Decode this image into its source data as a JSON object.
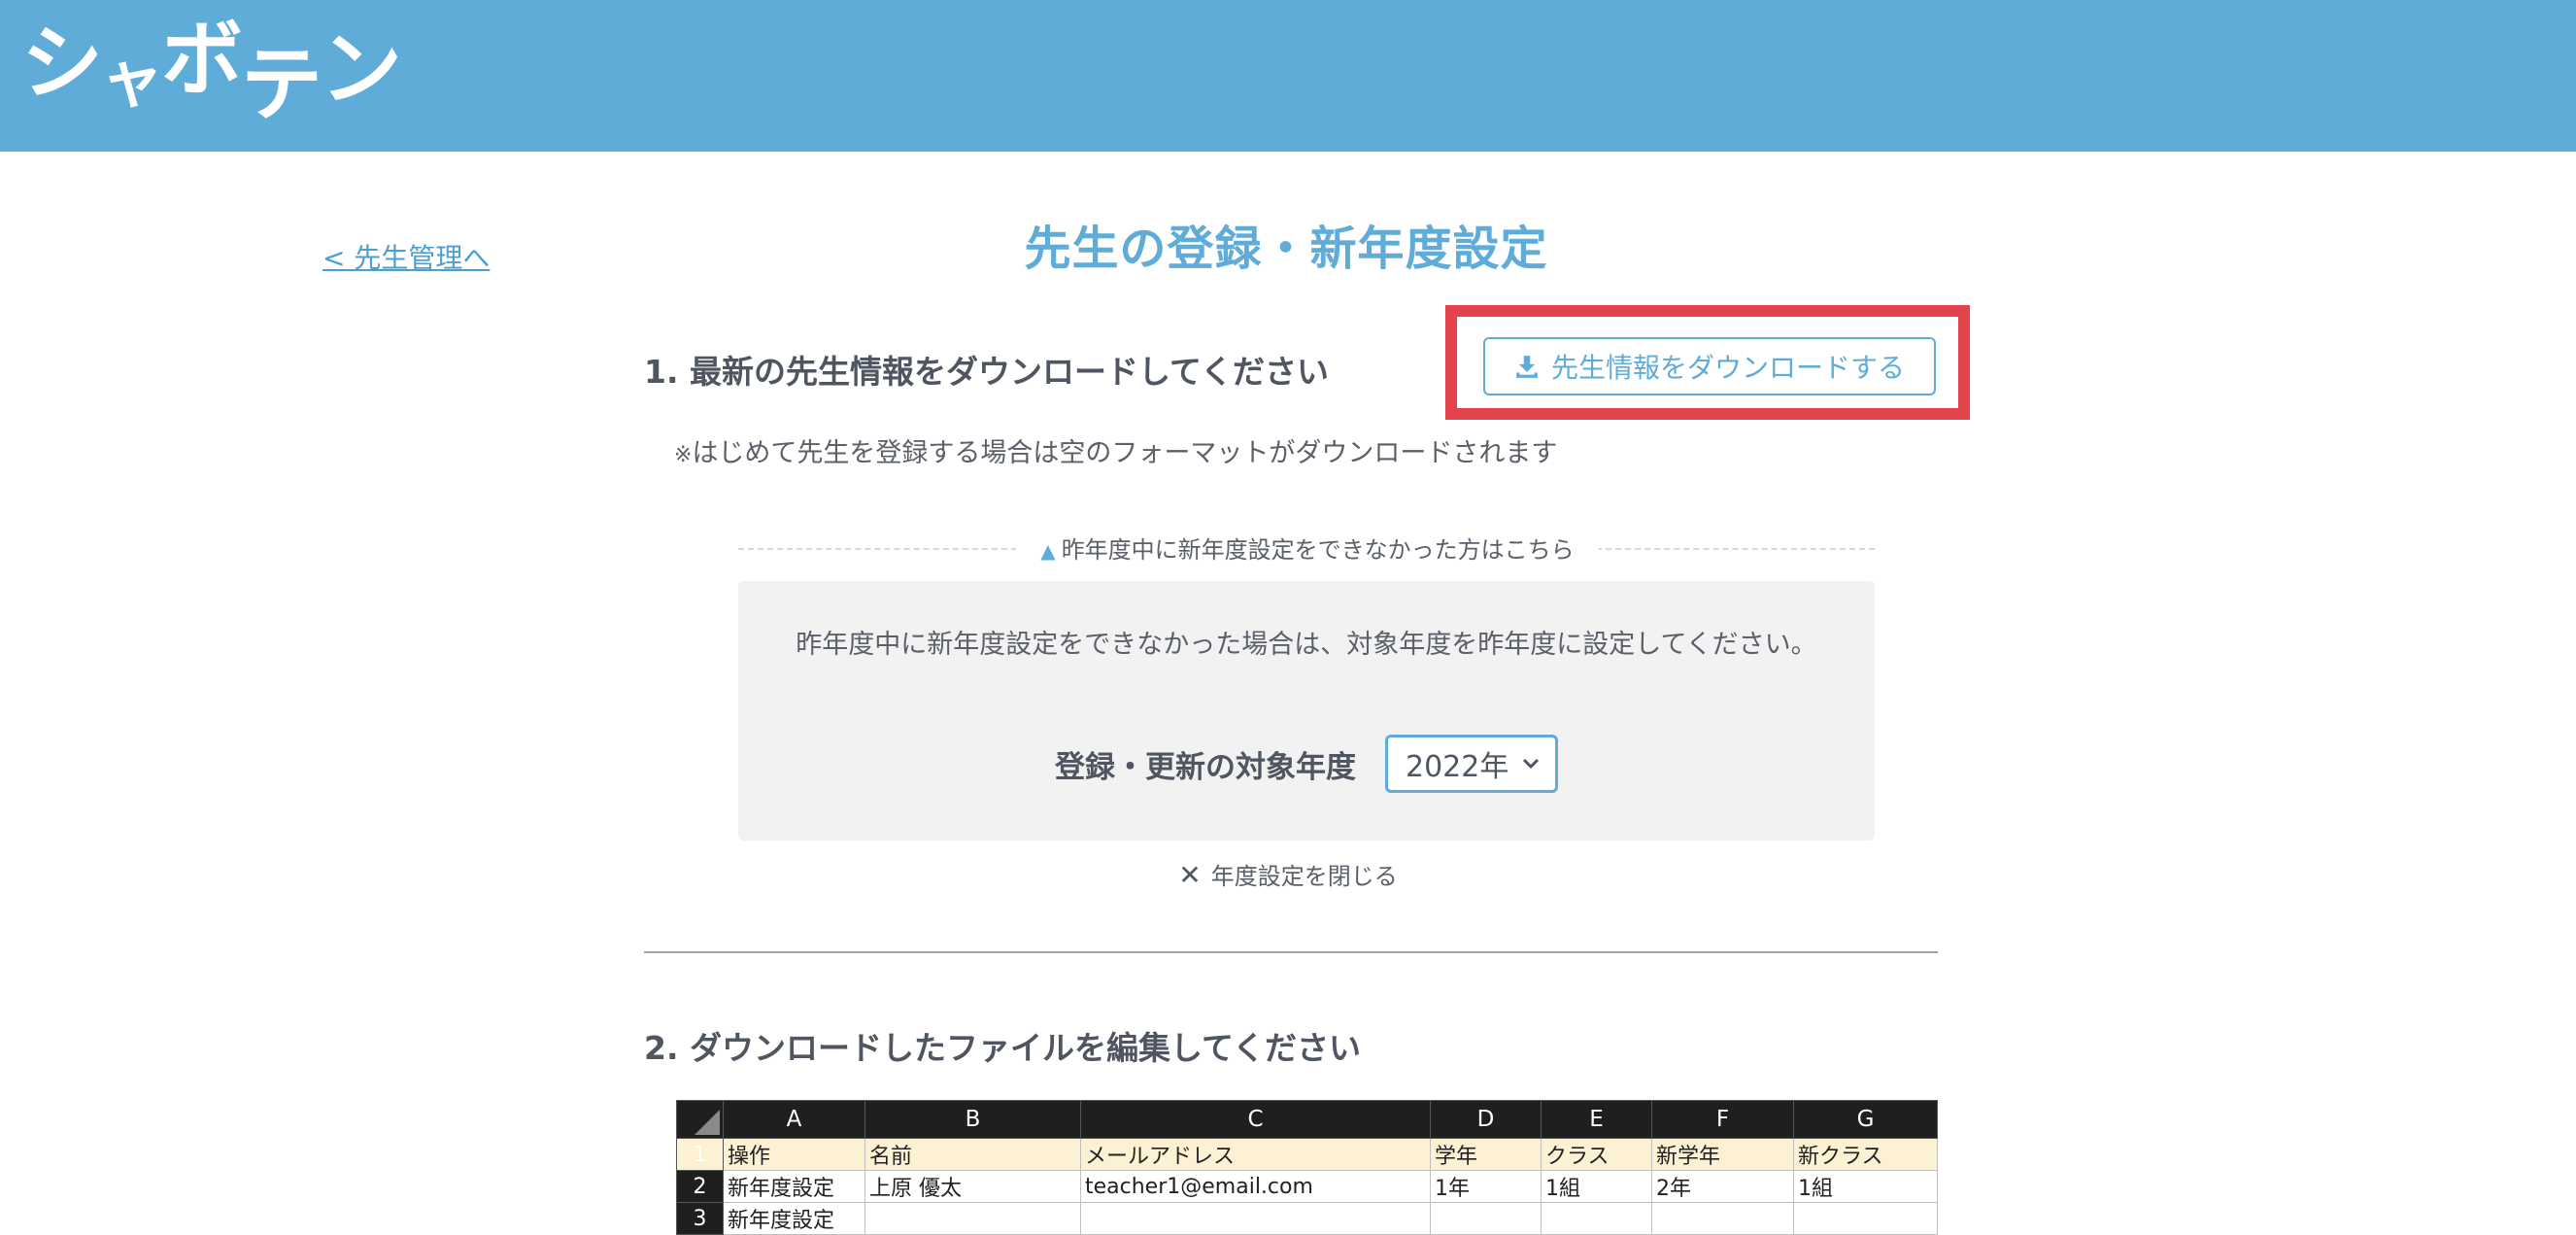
{
  "header": {
    "logo_chars": [
      "シ",
      "ャ",
      "ボ",
      "テ",
      "ン"
    ]
  },
  "nav": {
    "back_link": "< 先生管理へ"
  },
  "page": {
    "title": "先生の登録・新年度設定"
  },
  "step1": {
    "heading": "1. 最新の先生情報をダウンロードしてください",
    "download_button": "先生情報をダウンロードする",
    "note_mark": "※",
    "note": "はじめて先生を登録する場合は空のフォーマットがダウンロードされます"
  },
  "year_settings": {
    "toggle_label": "昨年度中に新年度設定をできなかった方はこちら",
    "description": "昨年度中に新年度設定をできなかった場合は、対象年度を昨年度に設定してください。",
    "target_year_label": "登録・更新の対象年度",
    "selected_year": "2022年",
    "close_label": "年度設定を閉じる"
  },
  "step2": {
    "heading": "2. ダウンロードしたファイルを編集してください"
  },
  "spreadsheet": {
    "columns": [
      "A",
      "B",
      "C",
      "D",
      "E",
      "F",
      "G"
    ],
    "rows": [
      {
        "num": "1",
        "cells": [
          "操作",
          "名前",
          "メールアドレス",
          "学年",
          "クラス",
          "新学年",
          "新クラス"
        ]
      },
      {
        "num": "2",
        "cells": [
          "新年度設定",
          "上原 優太",
          "teacher1@email.com",
          "1年",
          "1組",
          "2年",
          "1組"
        ]
      },
      {
        "num": "3",
        "cells": [
          "新年度設定",
          "",
          "",
          "",
          "",
          "",
          ""
        ]
      }
    ]
  },
  "colors": {
    "header_bg": "#5eacd7",
    "accent": "#5eacd7",
    "highlight": "#e4424d",
    "panel_bg": "#f2f2f2",
    "sheet_header_row": "#fdf1d3"
  },
  "icons": {
    "download": "download-icon",
    "triangle": "triangle-up-icon",
    "close": "close-icon",
    "chevron": "chevron-down-icon"
  }
}
